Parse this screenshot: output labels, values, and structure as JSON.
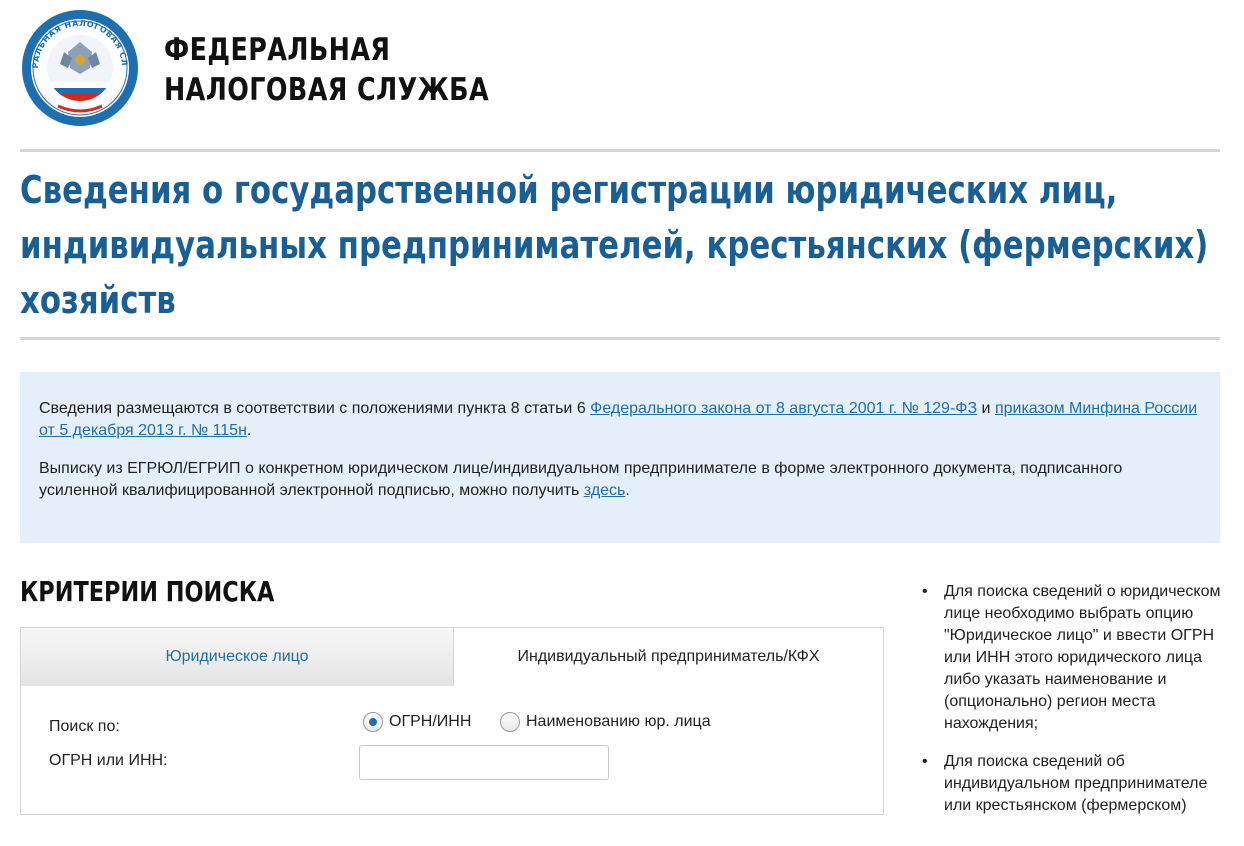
{
  "header": {
    "logo_label": "ФЕДЕРАЛЬНАЯ НАЛОГОВАЯ СЛУЖБА",
    "org_line1": "ФЕДЕРАЛЬНАЯ",
    "org_line2": "НАЛОГОВАЯ СЛУЖБА"
  },
  "page": {
    "title_line1": "Сведения о государственной регистрации юридических лиц,",
    "title_line2": "индивидуальных предпринимателей, крестьянских (фермерских)",
    "title_line3": "хозяйств"
  },
  "info": {
    "p1_text1": "Сведения размещаются в соответствии с положениями пункта 8 статьи 6 ",
    "p1_link1": "Федерального закона от 8 августа 2001 г. № 129-ФЗ",
    "p1_text2": " и ",
    "p1_link2": "приказом Минфина России от 5 декабря 2013 г. № 115н",
    "p1_text3": ".",
    "p2_text1": "Выписку из ЕГРЮЛ/ЕГРИП о конкретном юридическом лице/индивидуальном предпринимателе в форме электронного документа, подписанного усиленной квалифицированной электронной подписью, можно получить ",
    "p2_link": "здесь",
    "p2_text2": "."
  },
  "search": {
    "title": "КРИТЕРИИ ПОИСКА",
    "tabs": [
      {
        "label": "Юридическое лицо",
        "active": true
      },
      {
        "label": "Индивидуальный предприниматель/КФХ",
        "active": false
      }
    ],
    "search_by_label": "Поиск по:",
    "options": [
      {
        "label": "ОГРН/ИНН",
        "checked": true
      },
      {
        "label": "Наименованию юр. лица",
        "checked": false
      }
    ],
    "ogrn_label": "ОГРН или ИНН:",
    "ogrn_value": ""
  },
  "sidebar": {
    "notes": [
      "Для поиска сведений о юридическом лице необходимо выбрать опцию \"Юридическое лицо\" и ввести ОГРН или ИНН этого юридического лица либо указать наименование и (опционально) регион места нахождения;",
      "Для поиска сведений об индивидуальном предпринимателе или крестьянском (фермерском)"
    ]
  },
  "colors": {
    "brand_blue": "#1a5f94",
    "link_blue": "#1e6fa8",
    "info_bg": "#e5eff9"
  }
}
